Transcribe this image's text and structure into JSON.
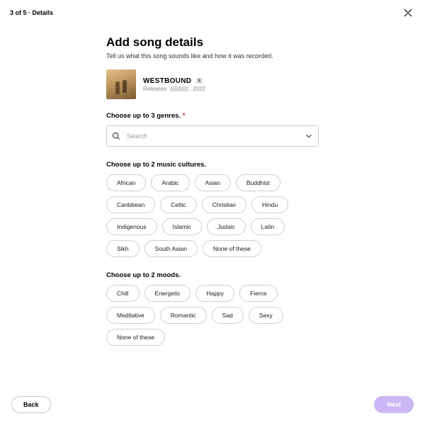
{
  "header": {
    "step_label": "3 of 5 · Details"
  },
  "page": {
    "title": "Add song details",
    "subtitle": "Tell us what this song sounds like and how it was recorded."
  },
  "song": {
    "title": "WESTBOUND",
    "badge": "E",
    "release_prefix": "Releases",
    "release_suffix": ", 2022"
  },
  "genres": {
    "label": "Choose up to 3 genres.",
    "search_placeholder": "Search"
  },
  "cultures": {
    "label": "Choose up to 2 music cultures.",
    "options": [
      "African",
      "Arabic",
      "Asian",
      "Buddhist",
      "Caribbean",
      "Celtic",
      "Christian",
      "Hindu",
      "Indigenous",
      "Islamic",
      "Judaic",
      "Latin",
      "Sikh",
      "South Asian",
      "None of these"
    ]
  },
  "moods": {
    "label": "Choose up to 2 moods.",
    "options": [
      "Chill",
      "Energetic",
      "Happy",
      "Fierce",
      "Meditative",
      "Romantic",
      "Sad",
      "Sexy",
      "None of these"
    ]
  },
  "footer": {
    "back": "Back",
    "next": "Next"
  }
}
